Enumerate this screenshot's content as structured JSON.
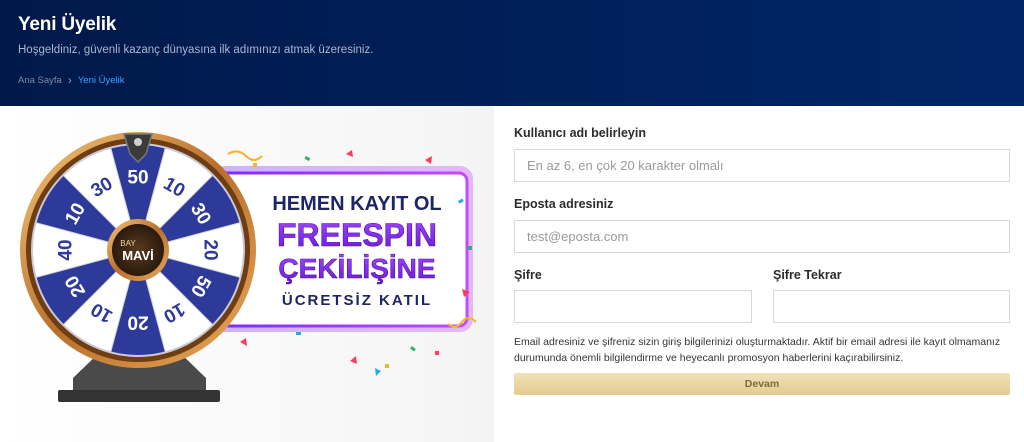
{
  "header": {
    "title": "Yeni Üyelik",
    "subtitle": "Hoşgeldiniz, güvenli kazanç dünyasına ilk adımınızı atmak üzeresiniz.",
    "breadcrumb": {
      "home": "Ana Sayfa",
      "current": "Yeni Üyelik"
    }
  },
  "promo": {
    "wheel_numbers": [
      "50",
      "10",
      "30",
      "20",
      "50",
      "10",
      "20",
      "10",
      "20",
      "40",
      "10",
      "30"
    ],
    "wheel_brand_top": "BAY",
    "wheel_brand_main": "MAVİ",
    "line1": "HEMEN KAYIT OL",
    "line2": "FREESPIN",
    "line3": "ÇEKİLİŞİNE",
    "line4": "ÜCRETSİZ KATIL"
  },
  "form": {
    "username_label": "Kullanıcı adı belirleyin",
    "username_placeholder": "En az 6, en çok 20 karakter olmalı",
    "email_label": "Eposta adresiniz",
    "email_placeholder": "test@eposta.com",
    "password_label": "Şifre",
    "password_confirm_label": "Şifre Tekrar",
    "note": "Email adresiniz ve şifreniz sizin giriş bilgilerinizi oluşturmaktadır. Aktif bir email adresi ile kayıt olmamanız durumunda önemli bilgilendirme ve heyecanlı promosyon haberlerini kaçırabilirsiniz.",
    "submit_label": "Devam"
  },
  "colors": {
    "header_bg": "#00205a",
    "breadcrumb_active": "#3fa0ff",
    "wheel_blue": "#2e3a9a",
    "wheel_gold": "#c98a3c",
    "banner_purple": "#6c1fc9",
    "submit_bg": "#e9d6a1"
  }
}
